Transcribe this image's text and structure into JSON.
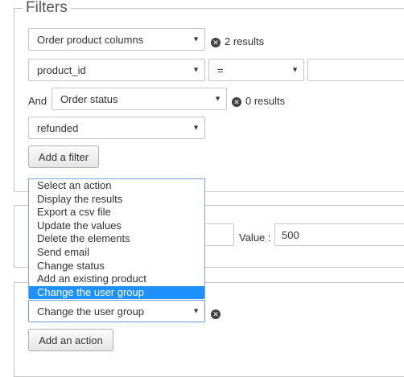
{
  "filters": {
    "title": "Filters",
    "row1": {
      "select_value": "Order product columns",
      "results": "2 results"
    },
    "row2": {
      "field": "product_id",
      "operator": "=",
      "value": ""
    },
    "and_label": "And",
    "row3": {
      "select_value": "Order status",
      "results": "0 results"
    },
    "row4": {
      "select_value": "refunded"
    },
    "add_filter_label": "Add a filter"
  },
  "middle": {
    "value_label": "Value :",
    "value_input": "500"
  },
  "actions": {
    "dropdown_options": [
      "Select an action",
      "Display the results",
      "Export a csv file",
      "Update the values",
      "Delete the elements",
      "Send email",
      "Change status",
      "Add an existing product",
      "Change the user group"
    ],
    "highlighted_option": "Change the user group",
    "select_value": "Change the user group",
    "add_action_label": "Add an action"
  },
  "icons": {
    "arrow": "▼",
    "clear": "✕"
  }
}
